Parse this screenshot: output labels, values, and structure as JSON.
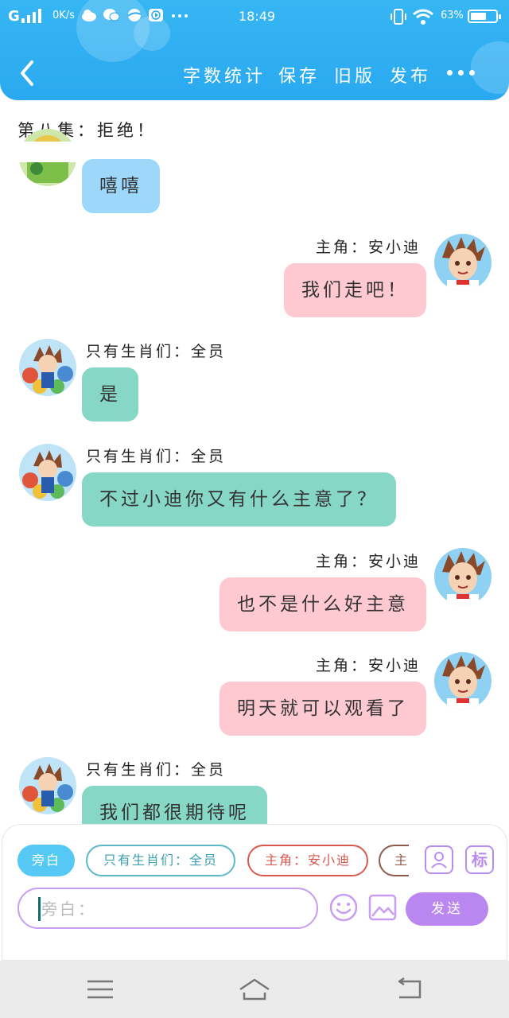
{
  "statusbar": {
    "signal": "G",
    "net_speed": "0K/s",
    "time": "18:49",
    "battery": "63%",
    "battery_level": 0.63
  },
  "navbar": {
    "back_icon": "chevron-left-icon",
    "items": [
      "字数统计",
      "保存",
      "旧版",
      "发布"
    ],
    "more_icon": "more-dots-icon"
  },
  "chapter_title": "第八集：拒绝！",
  "messages": [
    {
      "side": "left",
      "speaker": "",
      "text": "嘻嘻",
      "color": "#9dd8fb"
    },
    {
      "side": "right",
      "speaker": "主角：安小迪",
      "text": "我们走吧！",
      "color": "#ffc9d2"
    },
    {
      "side": "left",
      "speaker": "只有生肖们：全员",
      "text": "是",
      "color": "#87d7c6"
    },
    {
      "side": "left",
      "speaker": "只有生肖们：全员",
      "text": "不过小迪你又有什么主意了？",
      "color": "#87d7c6"
    },
    {
      "side": "right",
      "speaker": "主角：安小迪",
      "text": "也不是什么好主意",
      "color": "#ffc9d2"
    },
    {
      "side": "right",
      "speaker": "主角：安小迪",
      "text": "明天就可以观看了",
      "color": "#ffc9d2"
    },
    {
      "side": "left",
      "speaker": "只有生肖们：全员",
      "text": "我们都很期待呢",
      "color": "#87d7c6"
    }
  ],
  "role_chips": [
    {
      "label": "旁白",
      "active": true
    },
    {
      "label": "只有生肖们：全员",
      "active": false
    },
    {
      "label": "主角：安小迪",
      "active": false
    },
    {
      "label": "主",
      "active": false
    }
  ],
  "tools": {
    "role_manage_icon": "person-card-icon",
    "tag_label": "标"
  },
  "input": {
    "placeholder": "旁白：",
    "value": ""
  },
  "send_label": "发送",
  "system_nav": [
    "menu-icon",
    "home-icon",
    "back-icon"
  ]
}
